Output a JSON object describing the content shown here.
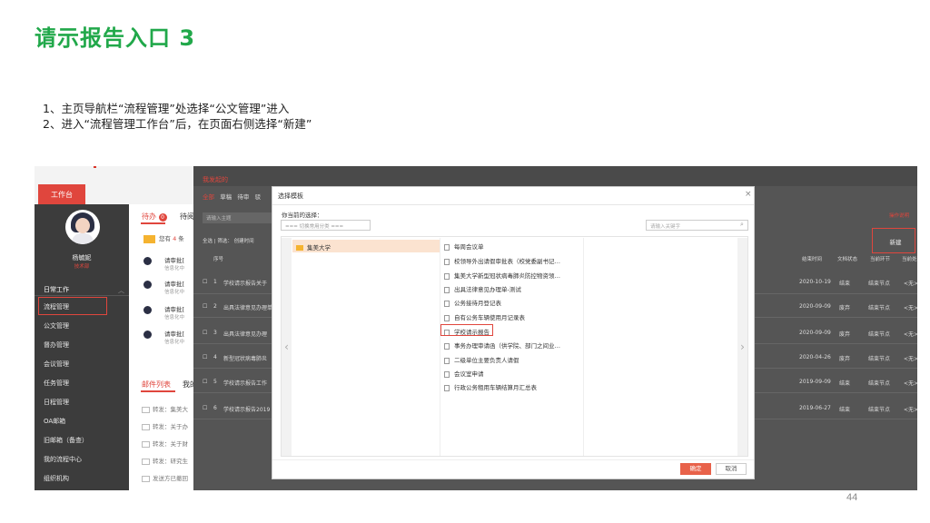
{
  "slide": {
    "title": "请示报告入口 3",
    "step1": "1、主页导航栏“流程管理”处选择“公文管理”进入",
    "step2": "2、进入“流程管理工作台”后，在页面右侧选择“新建”",
    "page_number": "44"
  },
  "portal": {
    "tab_workbench": "工作台",
    "user_name": "杨毓妮",
    "user_org": "技术部",
    "nav": [
      "日常工作",
      "流程管理",
      "公文管理",
      "督办管理",
      "会议管理",
      "任务管理",
      "日程管理",
      "OA邮箱",
      "旧邮箱（备查）",
      "我的流程中心",
      "组织机构"
    ],
    "todo_tab": "待办",
    "todo_count": "0",
    "todo_tab2": "待阅",
    "notice_prefix": "您有",
    "notice_count": "4",
    "notice_suffix": "条",
    "todo_items": [
      {
        "title": "请审批[",
        "sub": "信息化中"
      },
      {
        "title": "请审批[",
        "sub": "信息化中"
      },
      {
        "title": "请审批[",
        "sub": "信息化中"
      },
      {
        "title": "请审批[",
        "sub": "信息化中"
      }
    ],
    "mail_tab": "邮件列表",
    "mail_tab2": "我的",
    "mail_items": [
      "转发：集美大",
      "转发：关于办",
      "转发：关于财",
      "转发：研究生",
      "发送方已撤回"
    ]
  },
  "workflow": {
    "header": "我发起的",
    "tabs": [
      "全部",
      "草稿",
      "待审",
      "驳"
    ],
    "search_placeholder": "请输入主题",
    "top_link": "操作说明",
    "filters": "全选  | 筛选：  创建时间",
    "new_button": "新建",
    "columns": [
      "序号",
      "结束时间",
      "文档状态",
      "当前环节",
      "当前处理人"
    ],
    "rows": [
      {
        "no": "1",
        "title": "学校请示报告关于",
        "date": "2020-10-19",
        "status": "结束",
        "step": "结束节点",
        "handler": "<无>"
      },
      {
        "no": "2",
        "title": "出具法律意见办理单",
        "date": "2020-09-09",
        "status": "废弃",
        "step": "结束节点",
        "handler": "<无>"
      },
      {
        "no": "3",
        "title": "出具法律意见办理",
        "date": "2020-09-09",
        "status": "废弃",
        "step": "结束节点",
        "handler": "<无>"
      },
      {
        "no": "4",
        "title": "新型冠状病毒肺炎",
        "date": "2020-04-26",
        "status": "废弃",
        "step": "结束节点",
        "handler": "<无>"
      },
      {
        "no": "5",
        "title": "学校请示报告工作",
        "date": "2019-09-09",
        "status": "结束",
        "step": "结束节点",
        "handler": "<无>"
      },
      {
        "no": "6",
        "title": "学校请示报告2019",
        "date": "2019-06-27",
        "status": "结束",
        "step": "结束节点",
        "handler": "<无>"
      }
    ]
  },
  "modal": {
    "title": "选择模板",
    "close": "×",
    "current_label": "你当前的选择：",
    "category_select": "=== 切换常用分类 ===",
    "search_placeholder": "请输入关键字",
    "category": "集美大学",
    "templates": [
      "每周会议单",
      "校领导外出请假审批表（校党委副书记…",
      "集美大学新型冠状病毒肺炎防控物资领…",
      "出具法律意见办理单-测试",
      "公务接待月登记表",
      "自有公务车辆使用月记录表",
      "学校请示报告",
      "事务办理审请函（供学院、部门之间业…",
      "二级单位主要负责人请假",
      "会议室申请",
      "行政公务租用车辆结算月汇总表"
    ],
    "ok": "确定",
    "cancel": "取消",
    "arrow_left": "‹",
    "arrow_right": "›"
  },
  "colors": {
    "title_green": "#21a84a",
    "accent_red": "#e0463d",
    "sidebar": "#3c3c3c"
  }
}
